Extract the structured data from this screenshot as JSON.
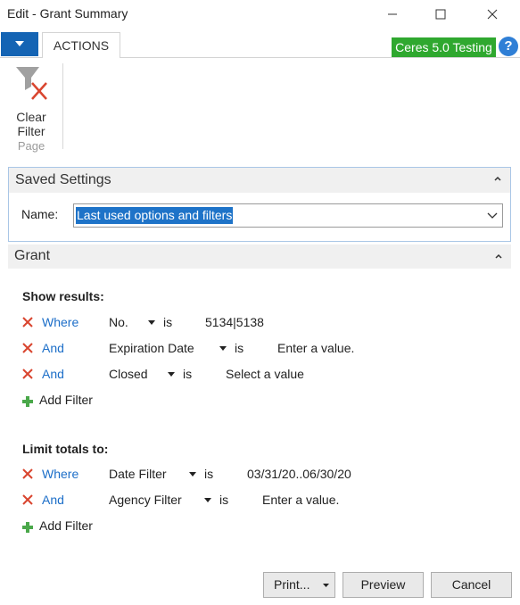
{
  "window": {
    "title": "Edit - Grant Summary"
  },
  "ribbon": {
    "tab_label": "ACTIONS",
    "environment_badge": "Ceres 5.0 Testing",
    "clear_filter_line1": "Clear",
    "clear_filter_line2": "Filter",
    "group_label": "Page"
  },
  "saved_settings": {
    "title": "Saved Settings",
    "name_label": "Name:",
    "name_value": "Last used options and filters"
  },
  "grant": {
    "title": "Grant",
    "show_results": {
      "heading": "Show results:",
      "filters": [
        {
          "join": "Where",
          "field": "No.",
          "operator": "is",
          "value": "5134|5138"
        },
        {
          "join": "And",
          "field": "Expiration Date",
          "operator": "is",
          "value": "Enter a value."
        },
        {
          "join": "And",
          "field": "Closed",
          "operator": "is",
          "value": "Select a value"
        }
      ],
      "add_filter": "Add Filter"
    },
    "limit_totals": {
      "heading": "Limit totals to:",
      "filters": [
        {
          "join": "Where",
          "field": "Date Filter",
          "operator": "is",
          "value": "03/31/20..06/30/20"
        },
        {
          "join": "And",
          "field": "Agency Filter",
          "operator": "is",
          "value": "Enter a value."
        }
      ],
      "add_filter": "Add Filter"
    }
  },
  "buttons": {
    "print": "Print...",
    "preview": "Preview",
    "cancel": "Cancel"
  },
  "colors": {
    "accent": "#1464b4",
    "badge": "#2fa82f",
    "link": "#1c6ec8",
    "remove": "#d9452f",
    "add": "#4aa84a"
  }
}
